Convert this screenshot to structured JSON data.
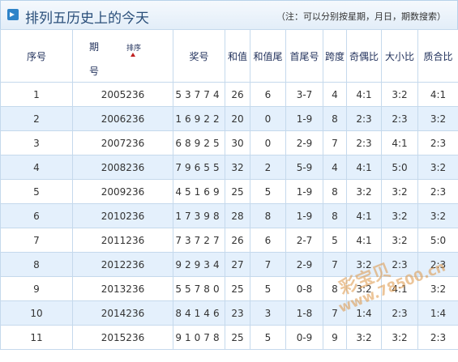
{
  "page": {
    "title": "排列五历史上的今天",
    "subtitle": "（注：可以分别按星期，月日，期数搜索）"
  },
  "table": {
    "headers": {
      "index": "序号",
      "issue_part1": "期",
      "issue_part2": "号",
      "sort": "排序",
      "award": "奖号",
      "sum": "和值",
      "sum_tail": "和值尾",
      "first_last": "首尾号",
      "span": "跨度",
      "odd_even": "奇偶比",
      "big_small": "大小比",
      "prime_composite": "质合比"
    },
    "rows": [
      {
        "index": "1",
        "issue": "2005236",
        "award": "53774",
        "sum": "26",
        "sum_tail": "6",
        "first_last": "3-7",
        "span": "4",
        "odd_even": "4:1",
        "big_small": "3:2",
        "prime_composite": "4:1"
      },
      {
        "index": "2",
        "issue": "2006236",
        "award": "16922",
        "sum": "20",
        "sum_tail": "0",
        "first_last": "1-9",
        "span": "8",
        "odd_even": "2:3",
        "big_small": "2:3",
        "prime_composite": "3:2"
      },
      {
        "index": "3",
        "issue": "2007236",
        "award": "68925",
        "sum": "30",
        "sum_tail": "0",
        "first_last": "2-9",
        "span": "7",
        "odd_even": "2:3",
        "big_small": "4:1",
        "prime_composite": "2:3"
      },
      {
        "index": "4",
        "issue": "2008236",
        "award": "79655",
        "sum": "32",
        "sum_tail": "2",
        "first_last": "5-9",
        "span": "4",
        "odd_even": "4:1",
        "big_small": "5:0",
        "prime_composite": "3:2"
      },
      {
        "index": "5",
        "issue": "2009236",
        "award": "45169",
        "sum": "25",
        "sum_tail": "5",
        "first_last": "1-9",
        "span": "8",
        "odd_even": "3:2",
        "big_small": "3:2",
        "prime_composite": "2:3"
      },
      {
        "index": "6",
        "issue": "2010236",
        "award": "17398",
        "sum": "28",
        "sum_tail": "8",
        "first_last": "1-9",
        "span": "8",
        "odd_even": "4:1",
        "big_small": "3:2",
        "prime_composite": "3:2"
      },
      {
        "index": "7",
        "issue": "2011236",
        "award": "73727",
        "sum": "26",
        "sum_tail": "6",
        "first_last": "2-7",
        "span": "5",
        "odd_even": "4:1",
        "big_small": "3:2",
        "prime_composite": "5:0"
      },
      {
        "index": "8",
        "issue": "2012236",
        "award": "92934",
        "sum": "27",
        "sum_tail": "7",
        "first_last": "2-9",
        "span": "7",
        "odd_even": "3:2",
        "big_small": "2:3",
        "prime_composite": "2:3"
      },
      {
        "index": "9",
        "issue": "2013236",
        "award": "55780",
        "sum": "25",
        "sum_tail": "5",
        "first_last": "0-8",
        "span": "8",
        "odd_even": "3:2",
        "big_small": "4:1",
        "prime_composite": "3:2"
      },
      {
        "index": "10",
        "issue": "2014236",
        "award": "84146",
        "sum": "23",
        "sum_tail": "3",
        "first_last": "1-8",
        "span": "7",
        "odd_even": "1:4",
        "big_small": "2:3",
        "prime_composite": "1:4"
      },
      {
        "index": "11",
        "issue": "2015236",
        "award": "91078",
        "sum": "25",
        "sum_tail": "5",
        "first_last": "0-9",
        "span": "9",
        "odd_even": "3:2",
        "big_small": "3:2",
        "prime_composite": "2:3"
      }
    ]
  },
  "watermark": {
    "line1": "彩宝贝",
    "line2": "www.78500.cn"
  },
  "colors": {
    "title": "#2a4f7a",
    "award_digits": "#b02020",
    "row_alt": "#e4f0fc",
    "border": "#c5d9ec"
  }
}
